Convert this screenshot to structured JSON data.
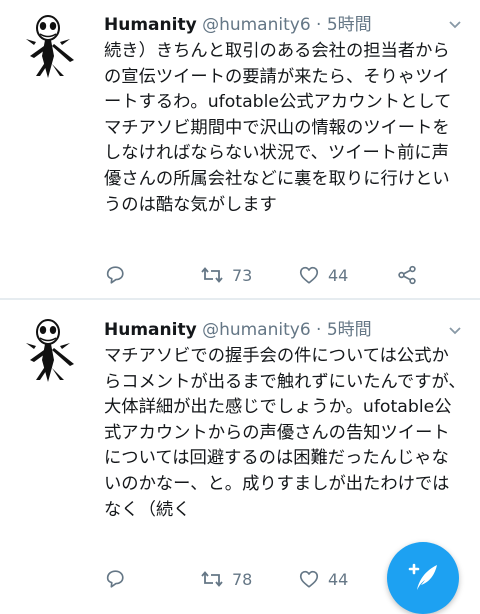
{
  "tweets": [
    {
      "name": "Humanity",
      "handle": "@humanity6",
      "separator": "·",
      "time": "5時間",
      "text": "続き）きちんと取引のある会社の担当者からの宣伝ツイートの要請が来たら、そりゃツイートするわ。ufotable公式アカウントとしてマチアソビ期間中で沢山の情報のツイートをしなければならない状況で、ツイート前に声優さんの所属会社などに裏を取りに行けというのは酷な気がします",
      "retweets": "73",
      "likes": "44"
    },
    {
      "name": "Humanity",
      "handle": "@humanity6",
      "separator": "·",
      "time": "5時間",
      "text": "マチアソビでの握手会の件については公式からコメントが出るまで触れずにいたんですが、大体詳細が出た感じでしょうか。ufotable公式アカウントからの声優さんの告知ツイートについては回避するのは困難だったんじゃないのかなー、と。成りすましが出たわけではなく（続く",
      "retweets": "78",
      "likes": "44"
    }
  ],
  "icons": {
    "avatar": "jack-skellington-avatar",
    "reply": "reply-icon",
    "retweet": "retweet-icon",
    "like": "heart-icon",
    "share": "share-icon",
    "menu": "chevron-down-icon",
    "compose": "compose-tweet-icon"
  },
  "colors": {
    "accent": "#1da1f2",
    "secondary_text": "#657786",
    "divider": "#e6ecf0"
  }
}
